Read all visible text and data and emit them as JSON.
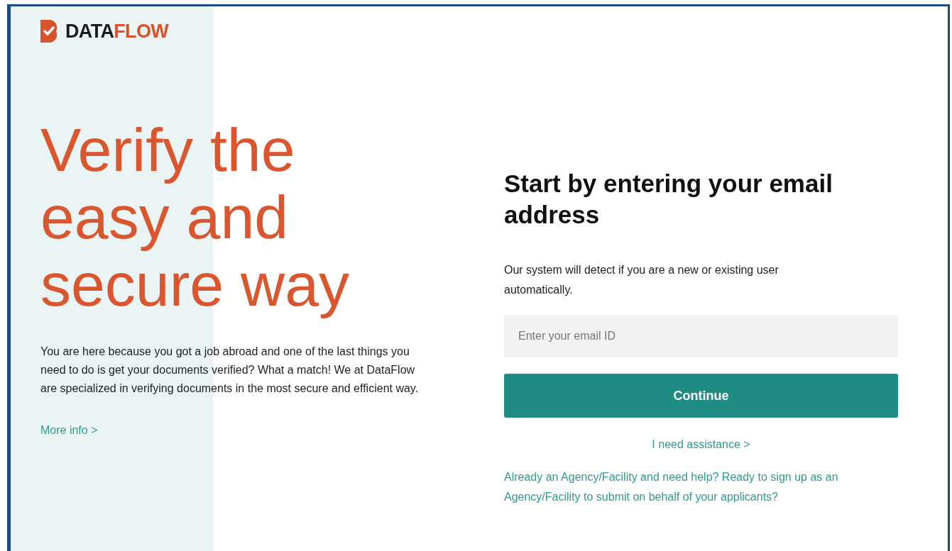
{
  "logo": {
    "primary": "DATA",
    "accent": "FLOW"
  },
  "hero": {
    "headline": "Verify the easy and secure way",
    "body": "You are here because you got a job abroad and one of the last things you need to do is get your documents verified? What a match! We at DataFlow are specialized in verifying documents in the most secure and efficient way.",
    "more_link": "More info >"
  },
  "form": {
    "title": "Start by entering your email address",
    "subtitle": "Our system will detect if you are a new or existing user automatically.",
    "email": {
      "placeholder": "Enter your email ID"
    },
    "submit": "Continue",
    "assistance_link": "I need assistance >",
    "agency_link": "Already an Agency/Facility and need help? Ready to sign up as an Agency/Facility to submit on behalf of your applicants?"
  }
}
